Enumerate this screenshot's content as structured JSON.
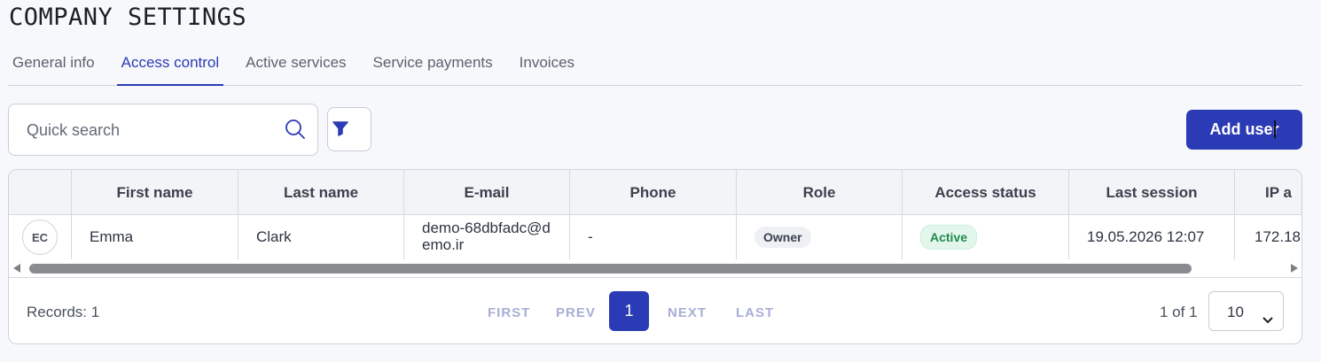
{
  "page": {
    "title": "COMPANY SETTINGS"
  },
  "tabs": [
    {
      "label": "General info",
      "active": false
    },
    {
      "label": "Access control",
      "active": true
    },
    {
      "label": "Active services",
      "active": false
    },
    {
      "label": "Service payments",
      "active": false
    },
    {
      "label": "Invoices",
      "active": false
    }
  ],
  "toolbar": {
    "search_placeholder": "Quick search",
    "search_icon": "search-icon",
    "filter_icon": "filter-icon",
    "add_user_label": "Add user"
  },
  "colors": {
    "accent": "#2b3bb5",
    "active_status": "#1f8a4c"
  },
  "table": {
    "columns": [
      "",
      "First name",
      "Last name",
      "E-mail",
      "Phone",
      "Role",
      "Access status",
      "Last session",
      "IP a"
    ],
    "rows": [
      {
        "avatar": "EC",
        "first_name": "Emma",
        "last_name": "Clark",
        "email": "demo-68dbfadc@demo.ir",
        "phone": "-",
        "role": "Owner",
        "access_status": "Active",
        "last_session": "19.05.2026 12:07",
        "ip": "172.18."
      }
    ]
  },
  "pagination": {
    "records": "Records: 1",
    "first": "FIRST",
    "prev": "PREV",
    "current": "1",
    "next": "NEXT",
    "last": "LAST",
    "page_of": "1 of 1",
    "per_page": "10"
  }
}
